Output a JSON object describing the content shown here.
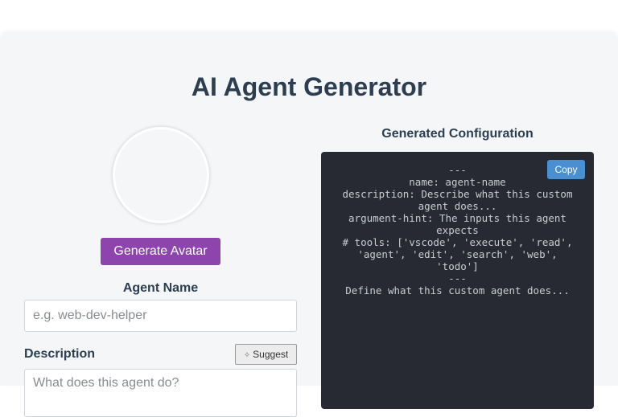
{
  "page": {
    "title": "AI Agent Generator"
  },
  "avatar": {
    "button_label": "Generate Avatar"
  },
  "form": {
    "agent_name": {
      "label": "Agent Name",
      "value": "",
      "placeholder": "e.g. web-dev-helper"
    },
    "description": {
      "label": "Description",
      "value": "",
      "placeholder": "What does this agent do?",
      "suggest_label": "Suggest"
    }
  },
  "config": {
    "heading": "Generated Configuration",
    "copy_label": "Copy",
    "code": "---\nname: agent-name\ndescription: Describe what this custom agent does...\nargument-hint: The inputs this agent expects\n# tools: ['vscode', 'execute', 'read', 'agent', 'edit', 'search', 'web', 'todo']\n---\nDefine what this custom agent does..."
  },
  "icons": {
    "suggest": "sparkle-icon"
  },
  "colors": {
    "accent": "#8e44ad",
    "title": "#2c3e50",
    "code_bg": "#272a33",
    "copy_button": "#4a8fd0"
  }
}
